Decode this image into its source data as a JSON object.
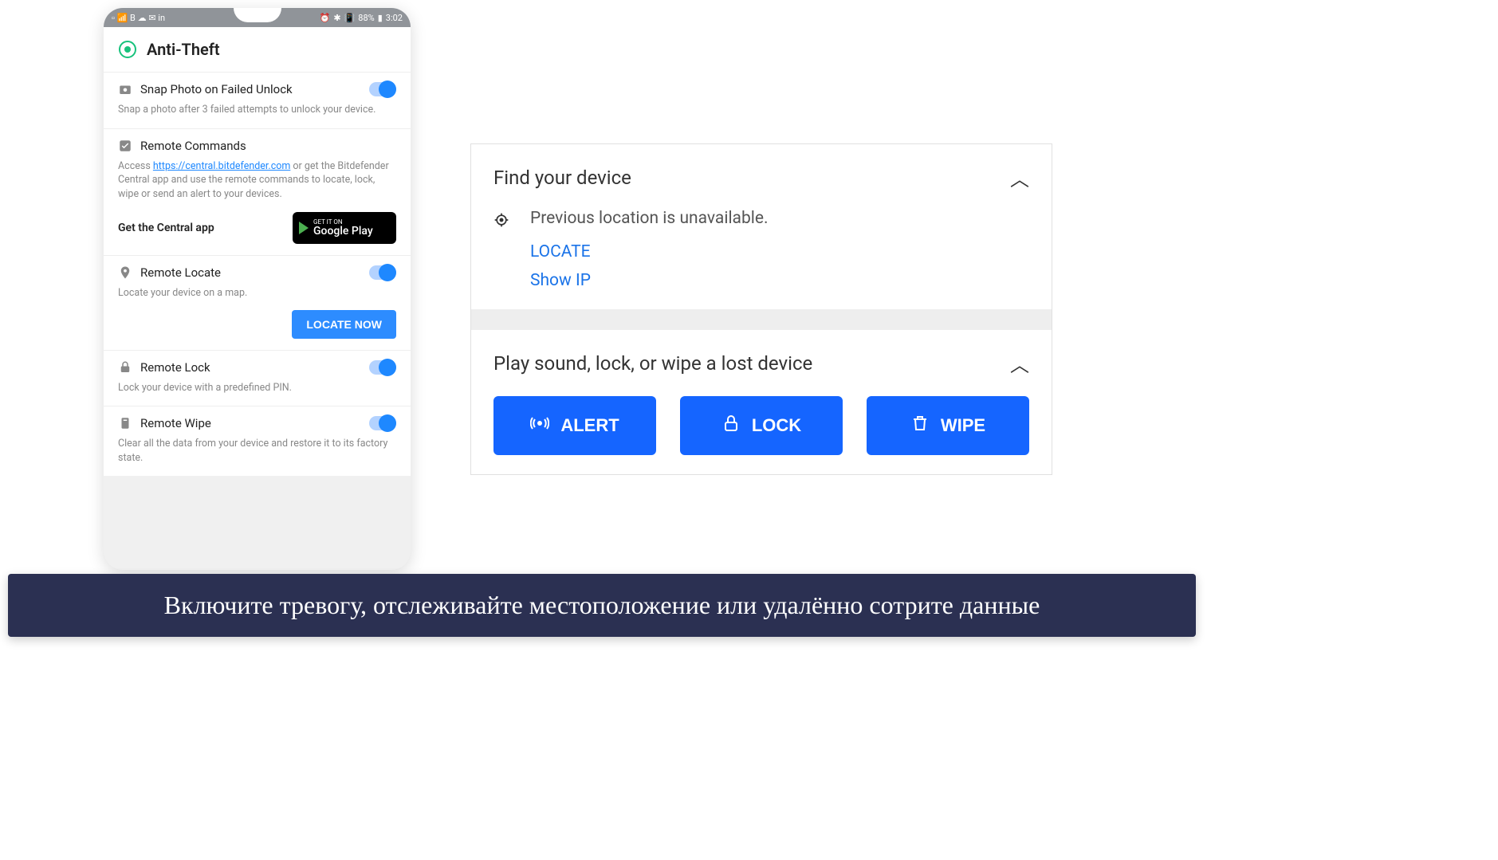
{
  "statusbar": {
    "battery": "88%",
    "time": "3:02"
  },
  "app": {
    "title": "Anti-Theft"
  },
  "sections": {
    "snap": {
      "title": "Snap Photo on Failed Unlock",
      "desc": "Snap a photo after 3 failed attempts to unlock your device."
    },
    "remote_cmds": {
      "title": "Remote Commands",
      "desc_pre": "Access ",
      "link": "https://central.bitdefender.com",
      "desc_post": " or get the Bitdefender Central app and use the remote commands to locate, lock, wipe or send an alert to your devices.",
      "get_central": "Get the Central app",
      "gplay_small": "GET IT ON",
      "gplay_big": "Google Play"
    },
    "locate": {
      "title": "Remote Locate",
      "desc": "Locate your device on a map.",
      "btn": "LOCATE NOW"
    },
    "lock": {
      "title": "Remote Lock",
      "desc": "Lock your device with a predefined PIN."
    },
    "wipe": {
      "title": "Remote Wipe",
      "desc": "Clear all the data from your device and restore it to its factory state."
    }
  },
  "web": {
    "find_title": "Find your device",
    "prev_location": "Previous location is unavailable.",
    "locate": "LOCATE",
    "show_ip": "Show IP",
    "actions_title": "Play sound, lock, or wipe a lost device",
    "alert": "ALERT",
    "lock": "LOCK",
    "wipe": "WIPE"
  },
  "caption": "Включите тревогу, отслеживайте местоположение или удалённо сотрите данные"
}
